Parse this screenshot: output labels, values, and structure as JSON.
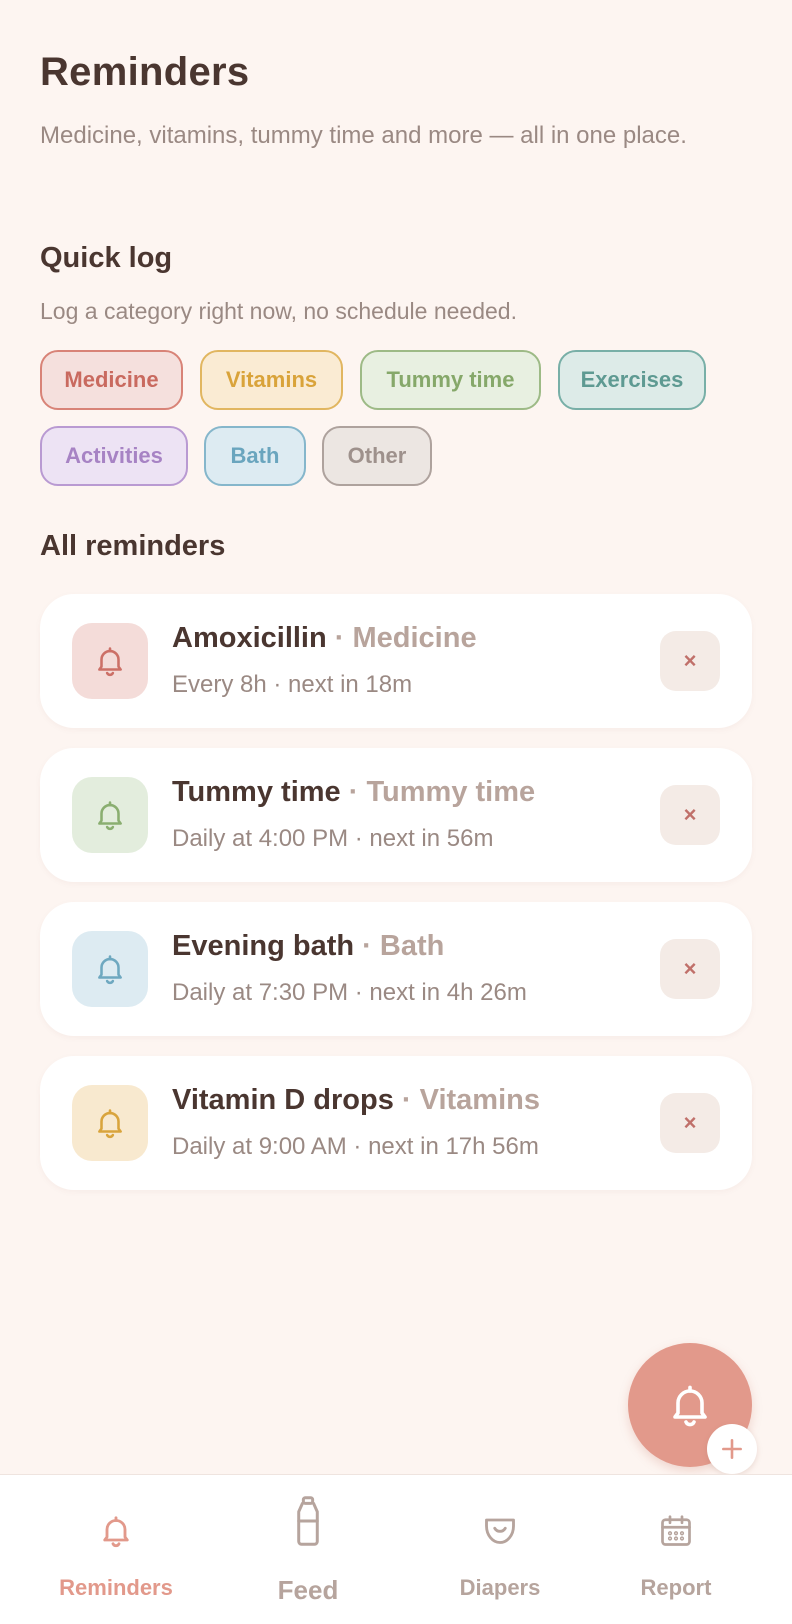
{
  "header": {
    "title": "Reminders",
    "subtitle": "Medicine, vitamins, tummy time and more — all in one place."
  },
  "quick_log": {
    "title": "Quick log",
    "subtitle": "Log a category right now, no schedule needed.",
    "chips": [
      {
        "label": "Medicine",
        "color": "#C96A5F",
        "bg": "#F5E0DD",
        "border": "#D88377"
      },
      {
        "label": "Vitamins",
        "color": "#D9A33A",
        "bg": "#FAEBD3",
        "border": "#E1B660"
      },
      {
        "label": "Tummy time",
        "color": "#86A86A",
        "bg": "#E8F0E1",
        "border": "#9DBA86"
      },
      {
        "label": "Exercises",
        "color": "#5E9A92",
        "bg": "#DDEBE8",
        "border": "#78AFA7"
      },
      {
        "label": "Activities",
        "color": "#A783C4",
        "bg": "#EDE3F4",
        "border": "#B99AD2"
      },
      {
        "label": "Bath",
        "color": "#6AA5BE",
        "bg": "#DDEBF2",
        "border": "#85B6CB"
      },
      {
        "label": "Other",
        "color": "#9E918C",
        "bg": "#ECE6E2",
        "border": "#AEA29D"
      }
    ]
  },
  "reminders": {
    "title": "All reminders",
    "items": [
      {
        "name": "Amoxicillin",
        "category": "Medicine",
        "separator": "·",
        "schedule": "Every 8h · next in 18m",
        "icon": "bell-icon",
        "icon_color": "#CC7067",
        "icon_bg": "#F4DCD9",
        "delete": "×"
      },
      {
        "name": "Tummy time",
        "category": "Tummy time",
        "separator": "·",
        "schedule": "Daily at 4:00 PM · next in 56m",
        "icon": "bell-icon",
        "icon_color": "#8AAE70",
        "icon_bg": "#E3EDDD",
        "delete": "×"
      },
      {
        "name": "Evening bath",
        "category": "Bath",
        "separator": "·",
        "schedule": "Daily at 7:30 PM · next in 4h 26m",
        "icon": "bell-icon",
        "icon_color": "#6EA8C0",
        "icon_bg": "#DDEBF2",
        "delete": "×"
      },
      {
        "name": "Vitamin D drops",
        "category": "Vitamins",
        "separator": "·",
        "schedule": "Daily at 9:00 AM · next in 17h 56m",
        "icon": "bell-icon",
        "icon_color": "#D9A43C",
        "icon_bg": "#F8E9CF",
        "delete": "×"
      }
    ]
  },
  "fab": {
    "icon": "bell-icon",
    "badge_icon": "plus-icon",
    "color": "#E2998B"
  },
  "tabbar": {
    "active": "Reminders",
    "active_color": "#E2998B",
    "items": [
      {
        "label": "Reminders",
        "icon": "bell-icon"
      },
      {
        "label": "Feed",
        "icon": "bottle-icon"
      },
      {
        "label": "Diapers",
        "icon": "diaper-icon"
      },
      {
        "label": "Report",
        "icon": "calendar-icon"
      }
    ]
  }
}
